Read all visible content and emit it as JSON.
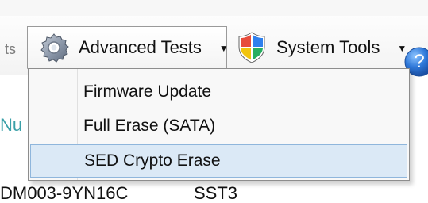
{
  "toolbar": {
    "left_fragment": "ts",
    "advanced_tests": {
      "label": "Advanced Tests",
      "icon": "gear-icon"
    },
    "system_tools": {
      "label": "System Tools",
      "icon": "shield-icon"
    },
    "help_icon": "help-icon"
  },
  "menu": {
    "items": [
      {
        "label": "Firmware Update",
        "selected": false
      },
      {
        "label": "Full Erase (SATA)",
        "selected": false
      },
      {
        "label": "SED Crypto Erase",
        "selected": true
      }
    ]
  },
  "background": {
    "left_label": "Nu",
    "row_text": "DM003-9YN16C",
    "row_text_2": "SST3"
  },
  "colors": {
    "menu_highlight": "#dbe9f6",
    "menu_highlight_border": "#8fb6dc",
    "left_label": "#3aa0a8",
    "help_blue": "#2f78d9"
  }
}
